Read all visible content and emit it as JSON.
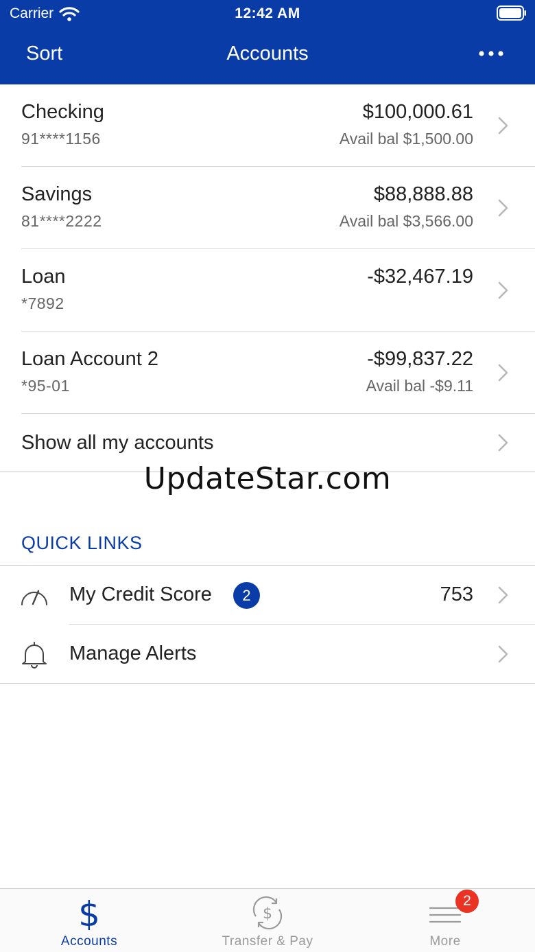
{
  "status_bar": {
    "carrier": "Carrier",
    "time": "12:42 AM"
  },
  "nav": {
    "sort_label": "Sort",
    "title": "Accounts",
    "more_icon": "ellipsis-icon"
  },
  "accounts": [
    {
      "name": "Checking",
      "number": "91****1156",
      "balance": "$100,000.61",
      "available": "Avail bal $1,500.00"
    },
    {
      "name": "Savings",
      "number": "81****2222",
      "balance": "$88,888.88",
      "available": "Avail bal $3,566.00"
    },
    {
      "name": "Loan",
      "number": "*7892",
      "balance": "-$32,467.19",
      "available": ""
    },
    {
      "name": "Loan Account 2",
      "number": "*95-01",
      "balance": "-$99,837.22",
      "available": "Avail bal -$9.11"
    }
  ],
  "show_all_label": "Show all my accounts",
  "watermark": "UpdateStar.com",
  "quick_links": {
    "title": "QUICK LINKS",
    "items": [
      {
        "label": "My Credit Score",
        "badge": "2",
        "value": "753",
        "icon": "speedometer-icon"
      },
      {
        "label": "Manage Alerts",
        "icon": "bell-icon"
      }
    ]
  },
  "tabs": [
    {
      "label": "Accounts",
      "icon": "dollar-icon",
      "active": true
    },
    {
      "label": "Transfer & Pay",
      "icon": "transfer-dollar-icon",
      "active": false
    },
    {
      "label": "More",
      "icon": "menu-lines-icon",
      "badge": "2",
      "active": false
    }
  ],
  "colors": {
    "brand": "#0a3ca8",
    "badge_red": "#ea3323",
    "inactive": "#9a9a9a"
  }
}
